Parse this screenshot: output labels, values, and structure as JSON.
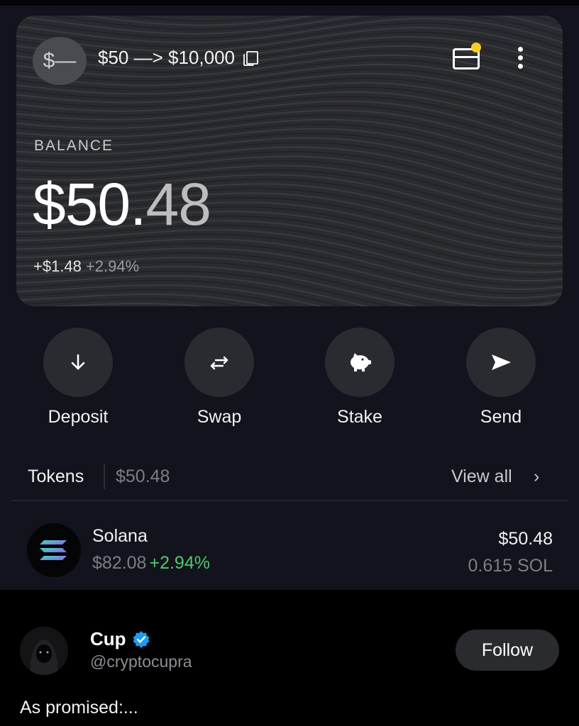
{
  "wallet": {
    "avatar_text": "$—",
    "name": "$50 —> $10,000",
    "has_notification": true
  },
  "balance": {
    "label": "BALANCE",
    "integer": "$50.",
    "decimal": "48",
    "change_abs": "+$1.48",
    "change_pct": "+2.94%"
  },
  "actions": [
    {
      "label": "Deposit",
      "icon": "arrow-down-icon"
    },
    {
      "label": "Swap",
      "icon": "swap-arrows-icon"
    },
    {
      "label": "Stake",
      "icon": "piggy-bank-icon"
    },
    {
      "label": "Send",
      "icon": "send-icon"
    }
  ],
  "tokens": {
    "title": "Tokens",
    "total": "$50.48",
    "view_all": "View all",
    "chevron": "›",
    "items": [
      {
        "name": "Solana",
        "price": "$82.08",
        "change": "+2.94%",
        "value": "$50.48",
        "amount": "0.615 SOL",
        "icon": "solana-logo"
      }
    ]
  },
  "tweet": {
    "name": "Cup",
    "verified": true,
    "handle": "@cryptocupra",
    "follow_label": "Follow",
    "text": "As promised:..."
  },
  "colors": {
    "app_bg": "#12131c",
    "card_bg": "#2a2b2f",
    "positive": "#4fc96c",
    "notification": "#f5d020",
    "verified": "#1d9bf0"
  }
}
